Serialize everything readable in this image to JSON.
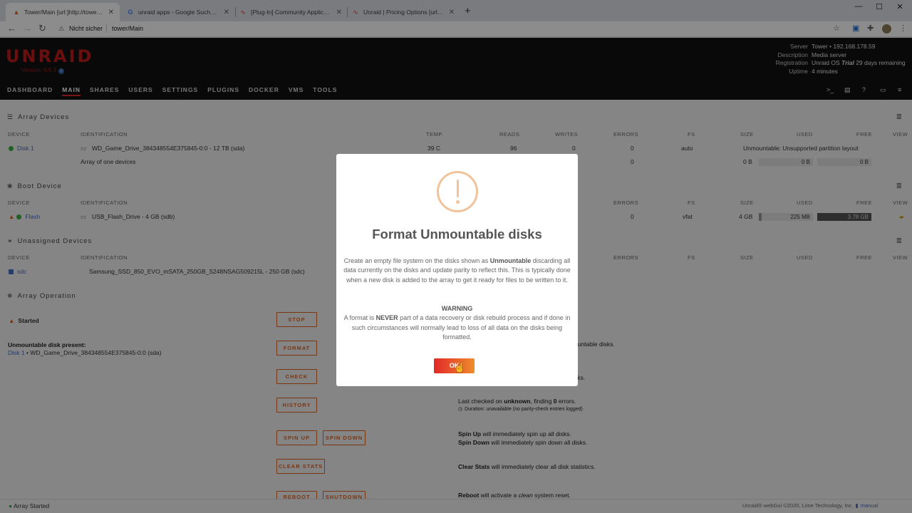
{
  "browser": {
    "tabs": [
      {
        "title": "Tower/Main [url:]http://tower/Ma",
        "active": true
      },
      {
        "title": "unraid apps - Google Suche [url:]",
        "active": false
      },
      {
        "title": "[Plug-In] Community Application",
        "active": false
      },
      {
        "title": "Unraid | Pricing Options [url:]http",
        "active": false
      }
    ],
    "security_label": "Nicht sicher",
    "url": "tower/Main"
  },
  "header": {
    "logo": "UNRAID",
    "version": "Version: 6.8.3",
    "server": {
      "server_k": "Server",
      "server_v": "Tower • 192.168.178.59",
      "desc_k": "Description",
      "desc_v": "Media server",
      "reg_k": "Registration",
      "reg_v_os": "Unraid OS ",
      "reg_v_trial": "Trial",
      "reg_v_rest": " 29 days remaining",
      "up_k": "Uptime",
      "up_v": "4 minutes"
    },
    "nav": [
      "DASHBOARD",
      "MAIN",
      "SHARES",
      "USERS",
      "SETTINGS",
      "PLUGINS",
      "DOCKER",
      "VMS",
      "TOOLS"
    ]
  },
  "sections": {
    "array": "Array Devices",
    "boot": "Boot Device",
    "unassigned": "Unassigned Devices",
    "operation": "Array Operation"
  },
  "cols": {
    "device": "DEVICE",
    "identification": "IDENTIFICATION",
    "temp": "TEMP.",
    "reads": "READS",
    "writes": "WRITES",
    "errors": "ERRORS",
    "fs": "FS",
    "size": "SIZE",
    "used": "USED",
    "free": "FREE",
    "view": "VIEW"
  },
  "array_rows": {
    "disk1_name": "Disk 1",
    "disk1_id": "WD_Game_Drive_384348554E375845-0:0 - 12 TB (sda)",
    "disk1_temp": "39 C",
    "disk1_reads": "96",
    "disk1_writes": "0",
    "disk1_errors": "0",
    "disk1_fs": "auto",
    "disk1_status": "Unmountable: Unsupported partition layout",
    "sum_label": "Array of one devices",
    "sum_errors": "0",
    "sum_size": "0 B",
    "sum_used": "0 B",
    "sum_free": "0 B"
  },
  "boot_row": {
    "name": "Flash",
    "id": "USB_Flash_Drive - 4 GB (sdb)",
    "errors": "0",
    "fs": "vfat",
    "size": "4 GB",
    "used": "225 MB",
    "free": "3.78 GB"
  },
  "unassigned_row": {
    "name": "sdc",
    "id": "Samsung_SSD_850_EVO_mSATA_250GB_S248NSAG509215L - 250 GB (sdc)"
  },
  "operation": {
    "status": "Started",
    "unmountable_title": "Unmountable disk present:",
    "unmountable_disk_link": "Disk 1",
    "unmountable_disk_rest": " • WD_Game_Drive_384348554E375845-0:0 (sda)",
    "buttons": {
      "stop": "STOP",
      "format": "FORMAT",
      "check": "CHECK",
      "history": "HISTORY",
      "spin_up": "SPIN UP",
      "spin_down": "SPIN DOWN",
      "clear_stats": "CLEAR STATS",
      "reboot": "REBOOT",
      "shutdown": "SHUTDOWN"
    },
    "format_desc_tail": "ountable disks.",
    "check_desc_tail": "sks.",
    "last_checked_pre": "Last checked on ",
    "last_checked_b": "unknown",
    "last_checked_mid": ", finding ",
    "last_checked_n": "0",
    "last_checked_post": " errors.",
    "duration": "Duration: unavailable (no parity-check entries logged)",
    "spinup_b": "Spin Up",
    "spinup_rest": " will immediately spin up all disks.",
    "spindown_b": "Spin Down",
    "spindown_rest": " will immediately spin down all disks.",
    "clear_b": "Clear Stats",
    "clear_rest": " will immediately clear all disk statistics.",
    "reboot_b": "Reboot",
    "reboot_mid": " will activate a ",
    "reboot_i": "clean",
    "reboot_rest": " system reset."
  },
  "footer": {
    "status": "Array Started",
    "copyright": "Unraid® webGui ©2020, Lime Technology, Inc.",
    "manual": "manual"
  },
  "modal": {
    "title": "Format Unmountable disks",
    "p1_a": "Create an empty file system on the disks shown as ",
    "p1_b": "Unmountable",
    "p1_c": " discarding all data currently on the disks and update parity to reflect this. This is typically done when a new disk is added to the array to get it ready for files to be written to it.",
    "warning": "WARNING",
    "p2_a": "A format is ",
    "p2_b": "NEVER",
    "p2_c": " part of a data recovery or disk rebuild process and if done in such circumstances will normally lead to loss of all data on the disks being formatted.",
    "ok": "OK"
  },
  "colors": {
    "accent": "#e22828",
    "orange": "#e06424",
    "green": "#3cb043"
  }
}
